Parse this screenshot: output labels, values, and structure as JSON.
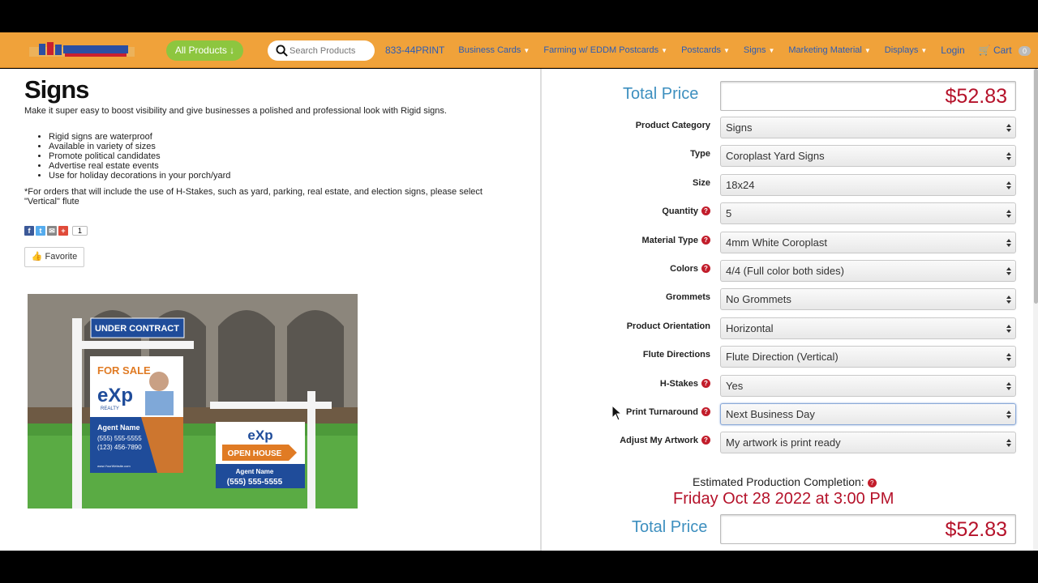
{
  "nav": {
    "all_products": "All Products ↓",
    "search_placeholder": "Search Products",
    "phone": "833-44PRINT",
    "links": [
      "Business Cards",
      "Farming w/ EDDM Postcards",
      "Postcards",
      "Signs",
      "Marketing Material",
      "Displays"
    ],
    "login": "Login",
    "cart": "Cart",
    "cart_count": "0"
  },
  "product": {
    "title": "Signs",
    "intro": "Make it super easy to boost visibility and give businesses a polished and professional look with Rigid signs.",
    "bullets": [
      "Rigid signs are waterproof",
      "Available in variety of sizes",
      "Promote political candidates",
      "Advertise real estate events",
      "Use for holiday decorations in your porch/yard"
    ],
    "note": "*For orders that will include the use of H-Stakes, such as yard, parking, real estate, and election signs, please select \"Vertical\" flute",
    "share_count": "1",
    "favorite": "Favorite"
  },
  "image_text": {
    "under_contract": "UNDER CONTRACT",
    "for_sale": "FOR SALE",
    "brand": "eXp",
    "brand_sub": "REALTY",
    "agent_name": "Agent Name",
    "phone1": "(555) 555-5555",
    "phone2": "(123) 456-7890",
    "website": "www.YourWebsite.com",
    "open_house": "OPEN HOUSE"
  },
  "config": {
    "total_label": "Total Price",
    "total_value": "$52.83",
    "rows": [
      {
        "label": "Product Category",
        "value": "Signs",
        "help": false
      },
      {
        "label": "Type",
        "value": "Coroplast Yard Signs",
        "help": false
      },
      {
        "label": "Size",
        "value": "18x24",
        "help": false
      },
      {
        "label": "Quantity",
        "value": "5",
        "help": true
      },
      {
        "label": "Material Type",
        "value": "4mm White Coroplast",
        "help": true
      },
      {
        "label": "Colors",
        "value": "4/4 (Full color both sides)",
        "help": true
      },
      {
        "label": "Grommets",
        "value": "No Grommets",
        "help": false
      },
      {
        "label": "Product Orientation",
        "value": "Horizontal",
        "help": false
      },
      {
        "label": "Flute Directions",
        "value": "Flute Direction (Vertical)",
        "help": false
      },
      {
        "label": "H-Stakes",
        "value": "Yes",
        "help": true
      },
      {
        "label": "Print Turnaround",
        "value": "Next Business Day",
        "help": true
      },
      {
        "label": "Adjust My Artwork",
        "value": "My artwork is print ready",
        "help": true
      }
    ],
    "est_label": "Estimated Production Completion:",
    "est_date": "Friday Oct 28 2022 at 3:00 PM"
  },
  "colors": {
    "nav_bg": "#f0a23a",
    "accent_blue": "#3d8fbf",
    "price_red": "#b5122a",
    "all_products_green": "#8dc63f"
  }
}
